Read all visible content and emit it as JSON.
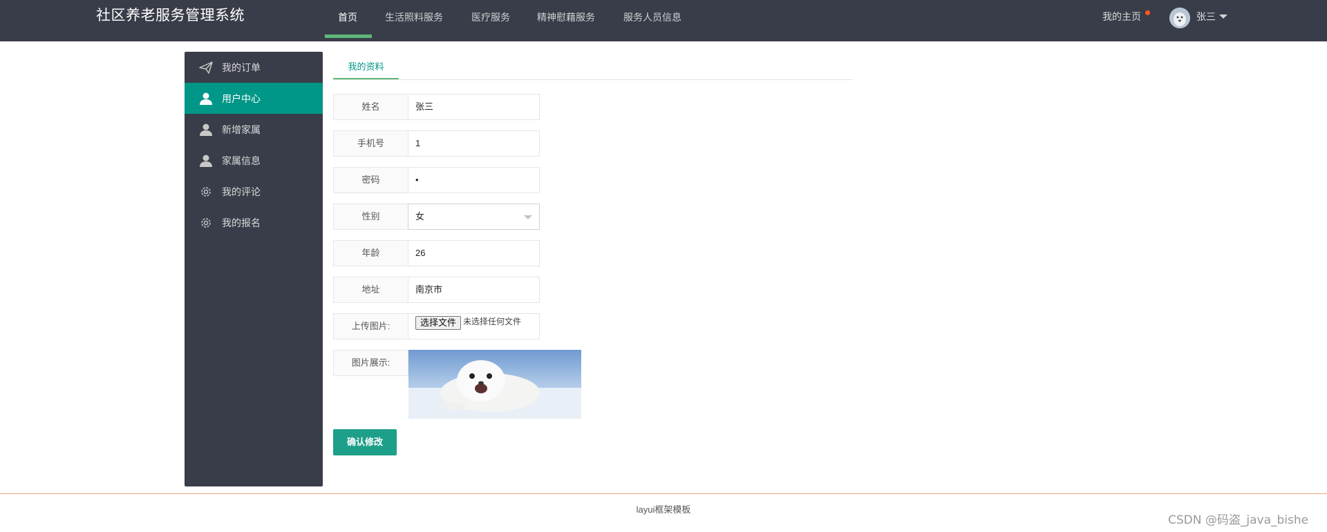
{
  "header": {
    "title": "社区养老服务管理系统",
    "nav": [
      {
        "label": "首页",
        "active": true
      },
      {
        "label": "生活照料服务",
        "active": false
      },
      {
        "label": "医疗服务",
        "active": false
      },
      {
        "label": "精神慰藉服务",
        "active": false
      },
      {
        "label": "服务人员信息",
        "active": false
      }
    ],
    "home_link": "我的主页",
    "username": "张三",
    "accent": "#5fb878",
    "notice_dot_color": "#ff5722"
  },
  "sidebar": {
    "items": [
      {
        "label": "我的订单",
        "icon": "paper-plane-icon",
        "active": false
      },
      {
        "label": "用户中心",
        "icon": "user-icon",
        "active": true
      },
      {
        "label": "新增家属",
        "icon": "user-icon",
        "active": false
      },
      {
        "label": "家属信息",
        "icon": "user-icon",
        "active": false
      },
      {
        "label": "我的评论",
        "icon": "gear-icon",
        "active": false
      },
      {
        "label": "我的报名",
        "icon": "gear-icon",
        "active": false
      }
    ],
    "active_color": "#009688"
  },
  "tabs": [
    {
      "label": "我的资料",
      "active": true
    }
  ],
  "form": {
    "name": {
      "label": "姓名",
      "value": "张三"
    },
    "phone": {
      "label": "手机号",
      "value": "1"
    },
    "password": {
      "label": "密码",
      "value": "•"
    },
    "gender": {
      "label": "性别",
      "value": "女"
    },
    "age": {
      "label": "年龄",
      "value": "26"
    },
    "address": {
      "label": "地址",
      "value": "南京市"
    },
    "upload": {
      "label": "上传图片:",
      "button": "选择文件",
      "status": "未选择任何文件"
    },
    "preview": {
      "label": "图片展示:"
    },
    "submit": "确认修改"
  },
  "footer": {
    "text": "layui框架模板"
  },
  "watermark": "CSDN @码盗_java_bishe"
}
